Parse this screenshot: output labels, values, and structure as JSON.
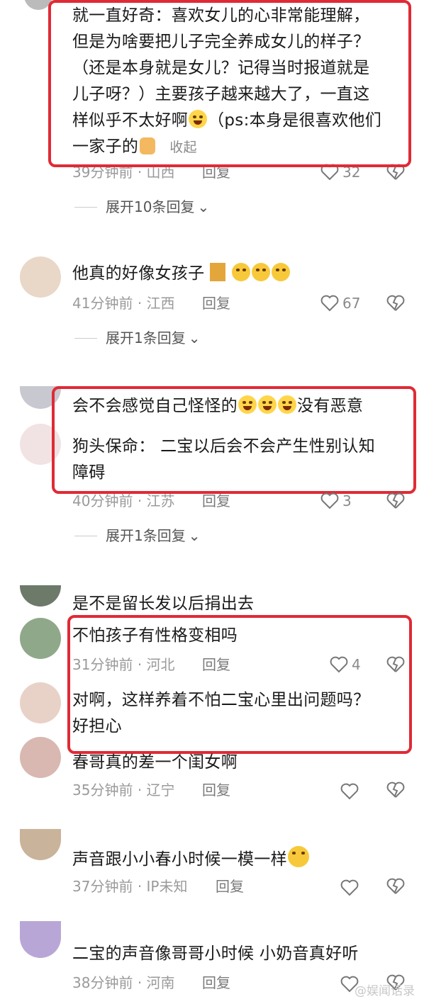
{
  "comments": [
    {
      "lines": [
        "就一直好奇：喜欢女儿的心非常能理解，",
        "但是为啥要把儿子完全养成女儿的样子？",
        "（还是本身就是女儿？记得当时报道就是",
        "儿子呀？）主要孩子越来越大了，一直这",
        "样似乎不太好啊",
        "一家子的"
      ],
      "line5_tail": "（ps:本身是很喜欢他们",
      "collapse": "收起",
      "time": "39分钟前",
      "location": "· 山西",
      "reply": "回复",
      "likes": "32",
      "expand": "展开10条回复"
    },
    {
      "text": "他真的好像女孩子",
      "time": "41分钟前",
      "location": "· 江西",
      "reply": "回复",
      "likes": "67",
      "expand": "展开1条回复"
    },
    {
      "text": "会不会感觉自己怪怪的",
      "tail": "没有恶意",
      "time": "40分钟前",
      "location": "· 江苏",
      "reply": "回复",
      "likes": "3",
      "expand": "展开1条回复",
      "reply_item": {
        "lines": [
          "狗头保命：    二宝以后会不会产生性别认知",
          "障碍"
        ]
      }
    },
    {
      "text": "是不是留长发以后捐出去"
    },
    {
      "text": "不怕孩子有性格变相吗",
      "time": "31分钟前",
      "location": "· 河北",
      "reply": "回复",
      "likes": "4"
    },
    {
      "lines": [
        "对啊，这样养着不怕二宝心里出问题吗？",
        "好担心"
      ]
    },
    {
      "text": "春哥真的差一个闺女啊",
      "time": "35分钟前",
      "location": "· 辽宁",
      "reply": "回复"
    },
    {
      "text": "声音跟小小春小时候一模一样",
      "time": "37分钟前",
      "location": "· IP未知",
      "reply": "回复"
    },
    {
      "text": "二宝的声音像哥哥小时候 小奶音真好听",
      "time": "38分钟前",
      "location": "· 河南",
      "reply": "回复"
    }
  ],
  "watermark": "@娱闻话录",
  "colors": {
    "highlight_box": "#e02a36",
    "meta_text": "#9a9a9a"
  }
}
